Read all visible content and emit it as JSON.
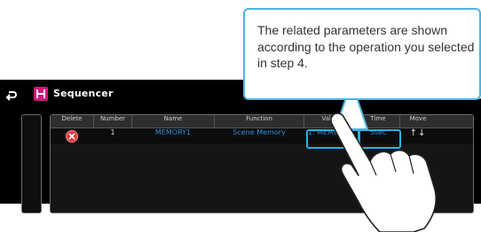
{
  "app": {
    "title": "Sequencer",
    "back_icon": "back-arrow-icon",
    "app_icon": "sequencer-app-icon",
    "right_icon": "settings-icon"
  },
  "table": {
    "headers": [
      "Delete",
      "Number",
      "Name",
      "Function",
      "Value",
      "Time",
      "Move"
    ],
    "rows": [
      {
        "delete_icon": "delete-x-icon",
        "number": "1",
        "name": "MEMORY1",
        "function": "Scene Memory",
        "value": "1: MEMORY1",
        "time": "5sec",
        "move": "↑↓"
      }
    ]
  },
  "callout": {
    "text": "The related parameters are shown according to the operation you selected in step 4."
  },
  "colors": {
    "highlight": "#27b3e6",
    "cell_text": "#2f8ee0",
    "delete": "#e43a3a",
    "app_icon": "#d0167a"
  }
}
